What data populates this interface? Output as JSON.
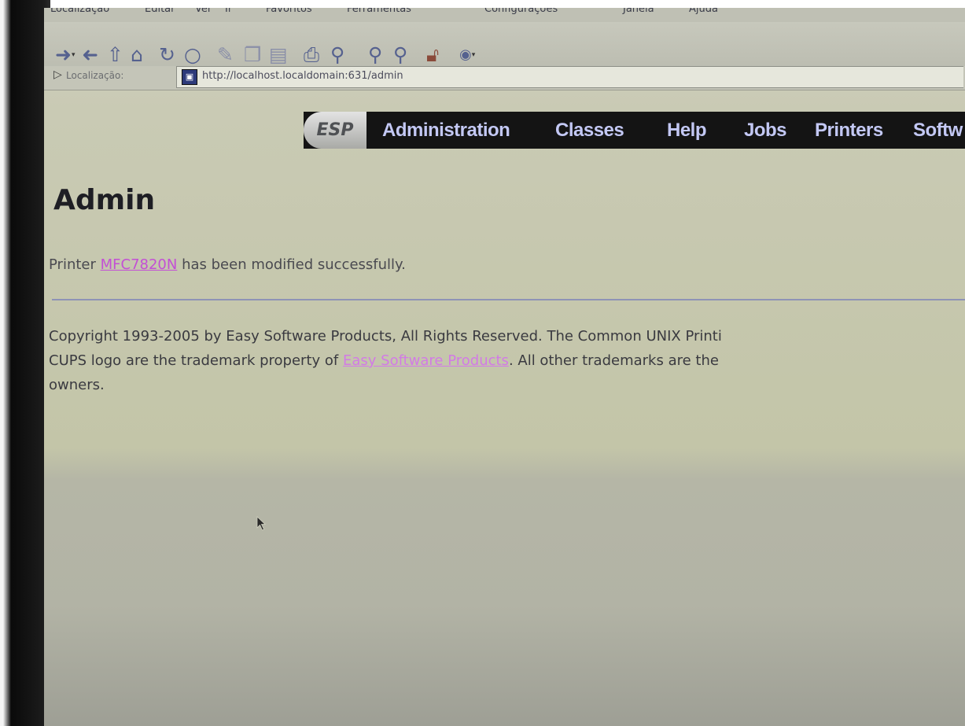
{
  "browser": {
    "menu": [
      "Localização",
      "Editar",
      "Ver",
      "Ir",
      "Favoritos",
      "Ferramentas",
      "Configurações",
      "Janela",
      "Ajuda"
    ],
    "location_label": "Localização:",
    "url": "http://localhost.localdomain:631/admin",
    "toolbar_icons": [
      "back-icon",
      "forward-icon",
      "up-icon",
      "home-icon",
      "reload-icon",
      "stop-icon",
      "bookmark-icon",
      "copy-icon",
      "paste-icon",
      "print-icon",
      "find-icon",
      "zoom-in-icon",
      "zoom-out-icon",
      "lock-icon",
      "extensions-icon"
    ]
  },
  "nav": {
    "logo": "ESP",
    "items": [
      "Administration",
      "Classes",
      "Help",
      "Jobs",
      "Printers",
      "Softw"
    ]
  },
  "page": {
    "title": "Admin",
    "message_prefix": "Printer",
    "printer_link": "MFC7820N",
    "message_suffix": "has been modified successfully.",
    "copyright_1": "Copyright 1993-2005 by Easy Software Products, All Rights Reserved. The Common UNIX Printi",
    "copyright_2a": "CUPS logo are the trademark property of",
    "copyright_link": "Easy Software Products",
    "copyright_2b": ". All other trademarks are the",
    "copyright_3": "owners."
  },
  "colors": {
    "nav_bg": "#141414",
    "nav_text": "#c3c8f4",
    "link": "#c34fd5",
    "page_bg": "#c9cab4"
  }
}
